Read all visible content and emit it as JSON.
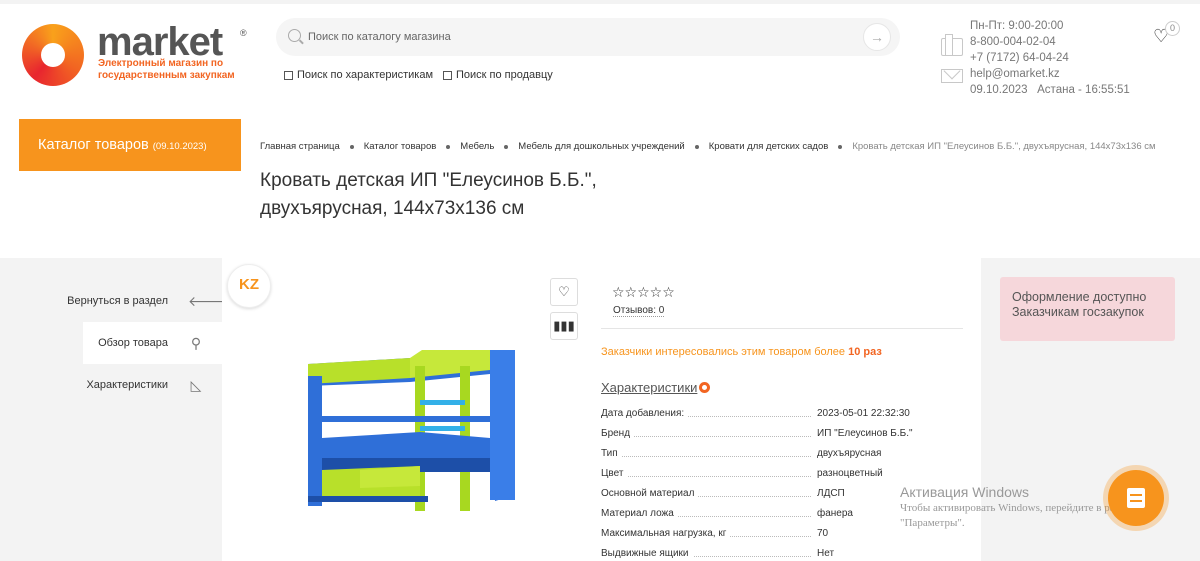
{
  "header": {
    "logo_word": "market",
    "logo_reg": "®",
    "logo_sub": "Электронный магазин по государственным закупкам",
    "search_placeholder": "Поиск по каталогу магазина",
    "search_go": "→",
    "check_characteristics": "Поиск по характеристикам",
    "check_seller": "Поиск по продавцу",
    "hours": "Пн-Пт: 9:00-20:00",
    "phone1": "8-800-004-02-04",
    "phone2": "+7 (7172) 64-04-24",
    "email": "help@omarket.kz",
    "datetime": "09.10.2023   Астана - 16:55:51",
    "fav_count": "0"
  },
  "catalog_button": {
    "label": "Каталог товаров",
    "date": "(09.10.2023)"
  },
  "breadcrumb": [
    "Главная страница",
    "Каталог товаров",
    "Мебель",
    "Мебель для дошкольных учреждений",
    "Кровати для детских садов",
    "Кровать детская ИП \"Елеусинов Б.Б.\", двухъярусная, 144х73х136 см"
  ],
  "title_line1": "Кровать детская ИП \"Елеусинов Б.Б.\",",
  "title_line2": "двухъярусная, 144х73х136 см",
  "nav": [
    {
      "label": "Вернуться в раздел",
      "icon": "arrow-left-icon",
      "glyph": "🡐"
    },
    {
      "label": "Обзор товара",
      "icon": "search-icon",
      "glyph": "⚲"
    },
    {
      "label": "Характеристики",
      "icon": "ruler-icon",
      "glyph": "◺"
    }
  ],
  "product": {
    "badge": "KZ",
    "stars": "☆☆☆☆☆",
    "reviews": "Отзывов: 0",
    "interest_text": "Заказчики интересовались этим товаром более ",
    "interest_count": "10 раз",
    "char_link": "Характеристики",
    "specs": [
      {
        "k": "Дата добавления:",
        "v": "2023-05-01 22:32:30"
      },
      {
        "k": "Бренд",
        "v": "ИП \"Елеусинов Б.Б.\""
      },
      {
        "k": "Тип",
        "v": "двухъярусная"
      },
      {
        "k": "Цвет",
        "v": "разноцветный"
      },
      {
        "k": "Основной материал",
        "v": "ЛДСП"
      },
      {
        "k": "Материал ложа",
        "v": "фанера"
      },
      {
        "k": "Максимальная нагрузка, кг",
        "v": "70"
      },
      {
        "k": "Выдвижные ящики",
        "v": "Нет"
      }
    ]
  },
  "notice": "Оформление доступно Заказчикам госзакупок",
  "watermark_title": "Активация Windows",
  "watermark_sub": "Чтобы активировать Windows, перейдите в раздел \"Параметры\".",
  "colors": {
    "accent": "#f7941d",
    "notice_bg": "#f6d7db"
  }
}
